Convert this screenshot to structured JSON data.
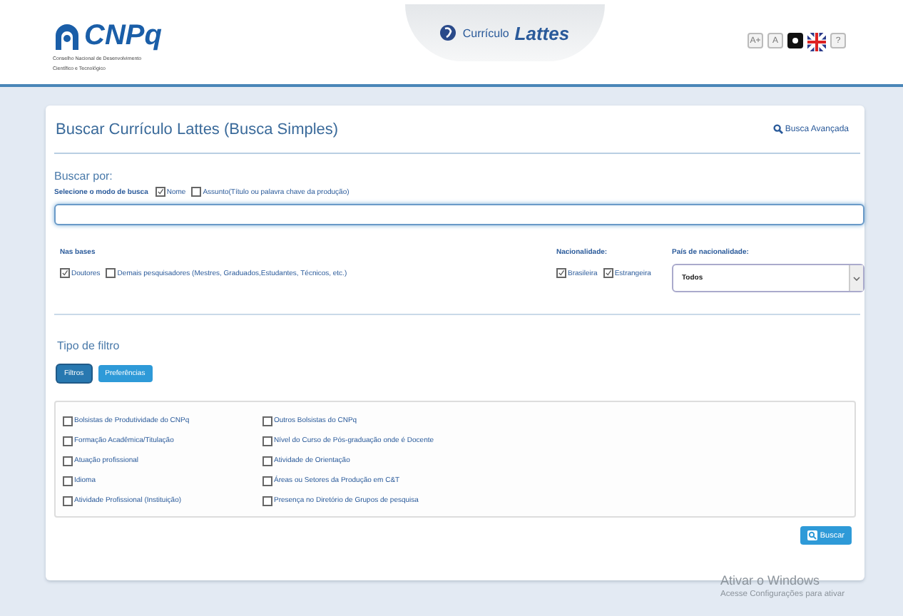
{
  "header": {
    "logo": {
      "name": "CNPq",
      "subtitle_lines": [
        "Conselho Nacional de Desenvolvimento",
        "Científico e Tecnológico"
      ]
    },
    "center_tab": {
      "prefix": "Currículo",
      "name": "Lattes"
    },
    "tools": [
      {
        "kind": "text",
        "label": "A+"
      },
      {
        "kind": "text",
        "label": "A"
      },
      {
        "kind": "contrast"
      },
      {
        "kind": "flag"
      },
      {
        "kind": "text",
        "label": "?"
      }
    ]
  },
  "panel": {
    "title": "Buscar Currículo Lattes (Busca Simples)",
    "advanced_link": "Busca Avançada",
    "search_by": {
      "heading": "Buscar por:",
      "mode_label": "Selecione o modo de busca",
      "modes": [
        {
          "label": "Nome",
          "checked": true
        },
        {
          "label": "Assunto(Título ou palavra chave da produção)",
          "checked": false
        }
      ],
      "query": {
        "focused": true
      }
    },
    "bases": {
      "heading": "Nas bases",
      "options": [
        {
          "label": "Doutores",
          "checked": true
        },
        {
          "label": "Demais pesquisadores (Mestres, Graduados,Estudantes, Técnicos, etc.)",
          "checked": false
        }
      ]
    },
    "nationality": {
      "heading": "Nacionalidade:",
      "options": [
        {
          "label": "Brasileira",
          "checked": true
        },
        {
          "label": "Estrangeira",
          "checked": true
        }
      ]
    },
    "country": {
      "heading": "País de nacionalidade:",
      "value": "Todos"
    },
    "filter_type": {
      "heading": "Tipo de filtro",
      "tabs": [
        {
          "label": "Filtros",
          "selected": true
        },
        {
          "label": "Preferências",
          "selected": false
        }
      ],
      "filters": [
        {
          "label": "Bolsistas de Produtividade do CNPq",
          "checked": false
        },
        {
          "label": "Formação Acadêmica/Titulação",
          "checked": false
        },
        {
          "label": "Atuação profissional",
          "checked": false
        },
        {
          "label": "Idioma",
          "checked": false
        },
        {
          "label": "Atividade Profissional (Instituição)",
          "checked": false
        },
        {
          "label": "Outros Bolsistas do CNPq",
          "checked": false
        },
        {
          "label": "Nível do Curso de Pós-graduação onde é Docente",
          "checked": false
        },
        {
          "label": "Atividade de Orientação",
          "checked": false
        },
        {
          "label": "Áreas ou Setores da Produção em C&T",
          "checked": false
        },
        {
          "label": "Presença no Diretório de Grupos de pesquisa",
          "checked": false
        }
      ]
    },
    "search_button": "Buscar"
  },
  "os_notice": {
    "title": "Ativar o Windows",
    "line": "Acesse Configurações para ativar"
  }
}
